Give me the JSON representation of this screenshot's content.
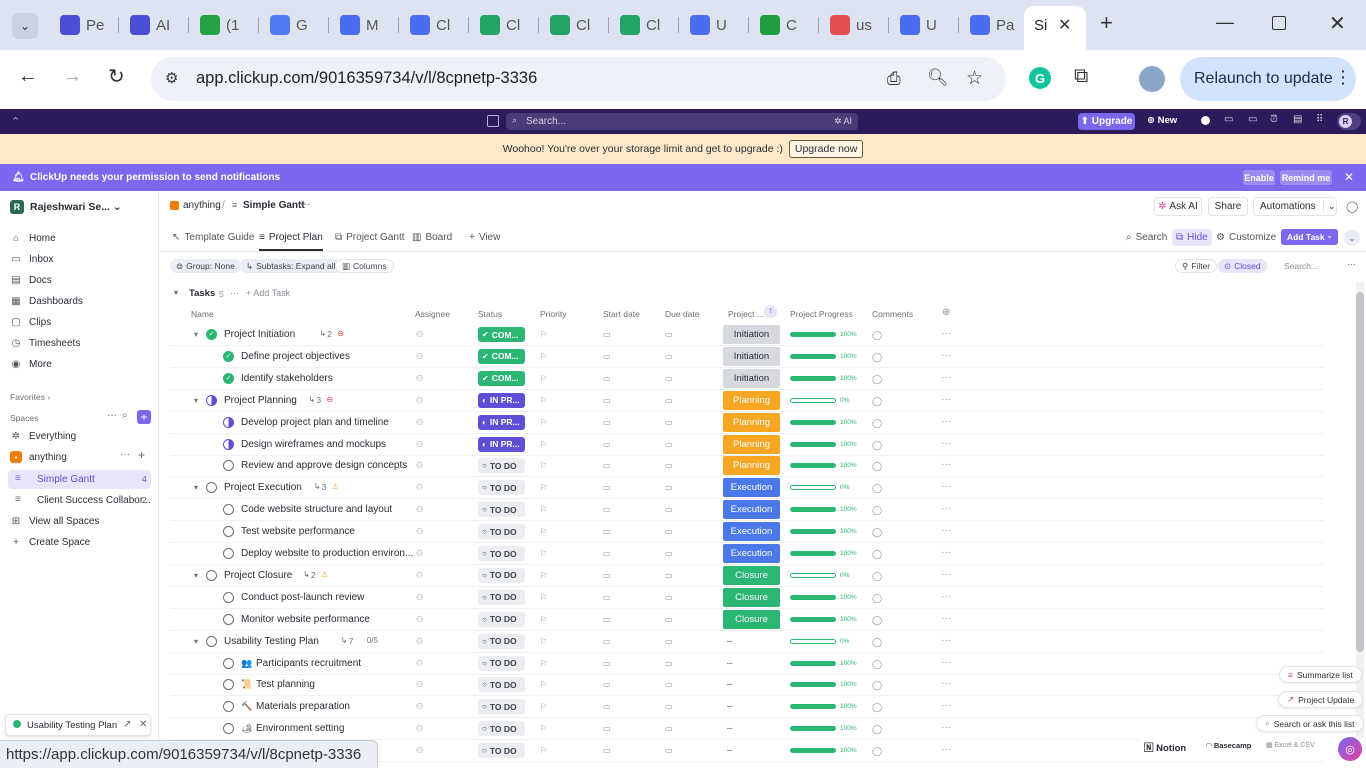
{
  "browser": {
    "tabs": [
      {
        "label": "Pe",
        "color": "#4c4ed6",
        "icon": "clickup-icon"
      },
      {
        "label": "AI",
        "color": "#4c4ed6",
        "icon": "clickup-icon"
      },
      {
        "label": "(1",
        "color": "#25a244",
        "icon": "whatsapp-icon"
      },
      {
        "label": "G",
        "color": "#4f7bf5",
        "icon": "gemini-icon"
      },
      {
        "label": "M",
        "color": "#4a6cf0",
        "icon": "docs-icon"
      },
      {
        "label": "Cl",
        "color": "#4a6cf0",
        "icon": "docs-icon"
      },
      {
        "label": "Cl",
        "color": "#21a464",
        "icon": "sheets-icon"
      },
      {
        "label": "Cl",
        "color": "#21a464",
        "icon": "sheets-icon"
      },
      {
        "label": "Cl",
        "color": "#21a464",
        "icon": "sheets-icon"
      },
      {
        "label": "U",
        "color": "#4a6cf0",
        "icon": "docs-icon"
      },
      {
        "label": "C",
        "color": "#1f9d3f",
        "icon": "check-icon"
      },
      {
        "label": "us",
        "color": "#e4504f",
        "icon": "chart-icon"
      },
      {
        "label": "U",
        "color": "#4a6cf0",
        "icon": "docs-icon"
      },
      {
        "label": "Pa",
        "color": "#4a6cf0",
        "icon": "docs-icon"
      }
    ],
    "active_tab_label": "Si",
    "url": "app.clickup.com/9016359734/v/l/8cpnetp-3336",
    "relaunch_label": "Relaunch to update",
    "status_url": "https://app.clickup.com/9016359734/v/l/8cpnetp-3336"
  },
  "topbar": {
    "search_placeholder": "Search...",
    "ai_label": "AI",
    "upgrade_label": "Upgrade",
    "new_label": "New",
    "avatar_letter": "R"
  },
  "banners": {
    "storage_text": "Woohoo! You're over your storage limit and get to upgrade :)",
    "storage_button": "Upgrade now",
    "notif_text": "ClickUp needs your permission to send notifications",
    "enable_label": "Enable",
    "remind_label": "Remind me"
  },
  "sidebar": {
    "workspace_letter": "R",
    "workspace_name": "Rajeshwari Se...",
    "nav": [
      "Home",
      "Inbox",
      "Docs",
      "Dashboards",
      "Clips",
      "Timesheets",
      "More"
    ],
    "favorites_label": "Favorites",
    "spaces_label": "Spaces",
    "everything_label": "Everything",
    "space_name": "anything",
    "lists": [
      {
        "name": "Simple Gantt",
        "count": "4"
      },
      {
        "name": "Client Success Collabor...",
        "count": "2"
      }
    ],
    "view_all_label": "View all Spaces",
    "create_space_label": "Create Space",
    "minimized_label": "Usability Testing Plan"
  },
  "header": {
    "breadcrumb_space": "anything",
    "breadcrumb_sep": "/",
    "breadcrumb_list": "Simple Gantt",
    "ask_ai": "Ask AI",
    "share": "Share",
    "automations": "Automations"
  },
  "views": {
    "tabs": [
      "Template Guide",
      "Project Plan",
      "Project Gantt",
      "Board"
    ],
    "add_view": "View",
    "search": "Search",
    "hide": "Hide",
    "customize": "Customize",
    "add_task": "Add Task"
  },
  "filters": {
    "group": "Group: None",
    "subtasks": "Subtasks: Expand all",
    "columns": "Columns",
    "filter": "Filter",
    "closed": "Closed",
    "search_placeholder": "Search..."
  },
  "table": {
    "group_label": "Tasks",
    "group_count": "5",
    "add_task": "Add Task",
    "columns": [
      "Name",
      "Assignee",
      "Status",
      "Priority",
      "Start date",
      "Due date",
      "Project ...",
      "Project Progress",
      "Comments"
    ],
    "status_styles": {
      "complete": {
        "label": "COM...",
        "bg": "#2bb673",
        "fg": "#ffffff"
      },
      "inprogress": {
        "label": "IN PR...",
        "bg": "#5f4fd6",
        "fg": "#ffffff"
      },
      "todo": {
        "label": "TO DO",
        "bg": "#ebedf0",
        "fg": "#3d4250"
      }
    },
    "phase_styles": {
      "Initiation": {
        "bg": "#d6d9de",
        "fg": "#292d34"
      },
      "Planning": {
        "bg": "#f6a623",
        "fg": "#ffffff"
      },
      "Execution": {
        "bg": "#4a78e8",
        "fg": "#ffffff"
      },
      "Closure": {
        "bg": "#2bb673",
        "fg": "#ffffff"
      }
    },
    "rows": [
      {
        "name": "Project Initiation",
        "level": 0,
        "status": "complete",
        "phase": "Initiation",
        "progress": 100,
        "sub": "2",
        "flag": "block"
      },
      {
        "name": "Define project objectives",
        "level": 1,
        "status": "complete",
        "phase": "Initiation",
        "progress": 100
      },
      {
        "name": "Identify stakeholders",
        "level": 1,
        "status": "complete",
        "phase": "Initiation",
        "progress": 100
      },
      {
        "name": "Project Planning",
        "level": 0,
        "status": "inprogress",
        "phase": "Planning",
        "progress": 0,
        "sub": "3",
        "flag": "block"
      },
      {
        "name": "Develop project plan and timeline",
        "level": 1,
        "status": "inprogress",
        "phase": "Planning",
        "progress": 100
      },
      {
        "name": "Design wireframes and mockups",
        "level": 1,
        "status": "inprogress",
        "phase": "Planning",
        "progress": 100
      },
      {
        "name": "Review and approve design concepts",
        "level": 1,
        "status": "todo",
        "phase": "Planning",
        "progress": 100
      },
      {
        "name": "Project Execution",
        "level": 0,
        "status": "todo",
        "phase": "Execution",
        "progress": 0,
        "sub": "3",
        "flag": "warn"
      },
      {
        "name": "Code website structure and layout",
        "level": 1,
        "status": "todo",
        "phase": "Execution",
        "progress": 100
      },
      {
        "name": "Test website performance",
        "level": 1,
        "status": "todo",
        "phase": "Execution",
        "progress": 100
      },
      {
        "name": "Deploy website to production environ...",
        "level": 1,
        "status": "todo",
        "phase": "Execution",
        "progress": 100
      },
      {
        "name": "Project Closure",
        "level": 0,
        "status": "todo",
        "phase": "Closure",
        "progress": 0,
        "sub": "2",
        "flag": "warn"
      },
      {
        "name": "Conduct post-launch review",
        "level": 1,
        "status": "todo",
        "phase": "Closure",
        "progress": 100
      },
      {
        "name": "Monitor website performance",
        "level": 1,
        "status": "todo",
        "phase": "Closure",
        "progress": 100
      },
      {
        "name": "Usability Testing Plan",
        "level": 0,
        "status": "todo",
        "phase": "–",
        "progress": 0,
        "sub": "7",
        "check": "0/5"
      },
      {
        "name": "Participants recruitment",
        "level": 1,
        "status": "todo",
        "phase": "–",
        "progress": 100,
        "emoji": "👥"
      },
      {
        "name": "Test planning",
        "level": 1,
        "status": "todo",
        "phase": "–",
        "progress": 100,
        "emoji": "📜"
      },
      {
        "name": "Materials preparation",
        "level": 1,
        "status": "todo",
        "phase": "–",
        "progress": 100,
        "emoji": "🔨"
      },
      {
        "name": "Environment setting",
        "level": 1,
        "status": "todo",
        "phase": "–",
        "progress": 100,
        "emoji": "🏕"
      },
      {
        "name": "",
        "level": 1,
        "status": "todo",
        "phase": "–",
        "progress": 100
      }
    ]
  },
  "floating": {
    "summarize": "Summarize list",
    "project_update": "Project Update",
    "ask": "Search or ask this list",
    "notion": "Notion",
    "basecamp": "Basecamp",
    "excel": "Excel & CSV"
  }
}
